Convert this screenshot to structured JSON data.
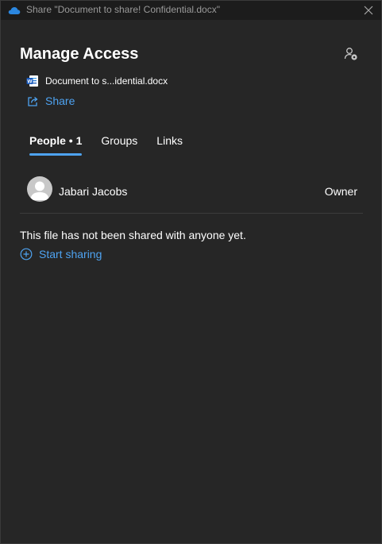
{
  "window": {
    "title": "Share \"Document to share! Confidential.docx\""
  },
  "header": {
    "heading": "Manage Access"
  },
  "file": {
    "name": "Document to s...idential.docx",
    "icon": "word-document-icon"
  },
  "share": {
    "label": "Share"
  },
  "tabs": [
    {
      "label": "People • 1",
      "active": true
    },
    {
      "label": "Groups",
      "active": false
    },
    {
      "label": "Links",
      "active": false
    }
  ],
  "people": [
    {
      "name": "Jabari Jacobs",
      "role": "Owner"
    }
  ],
  "empty_state": {
    "message": "This file has not been shared with anyone yet.",
    "action_label": "Start sharing"
  },
  "colors": {
    "accent": "#4ea3f1",
    "background": "#262626",
    "titlebar": "#1c1c1c",
    "word_blue": "#185abd"
  }
}
